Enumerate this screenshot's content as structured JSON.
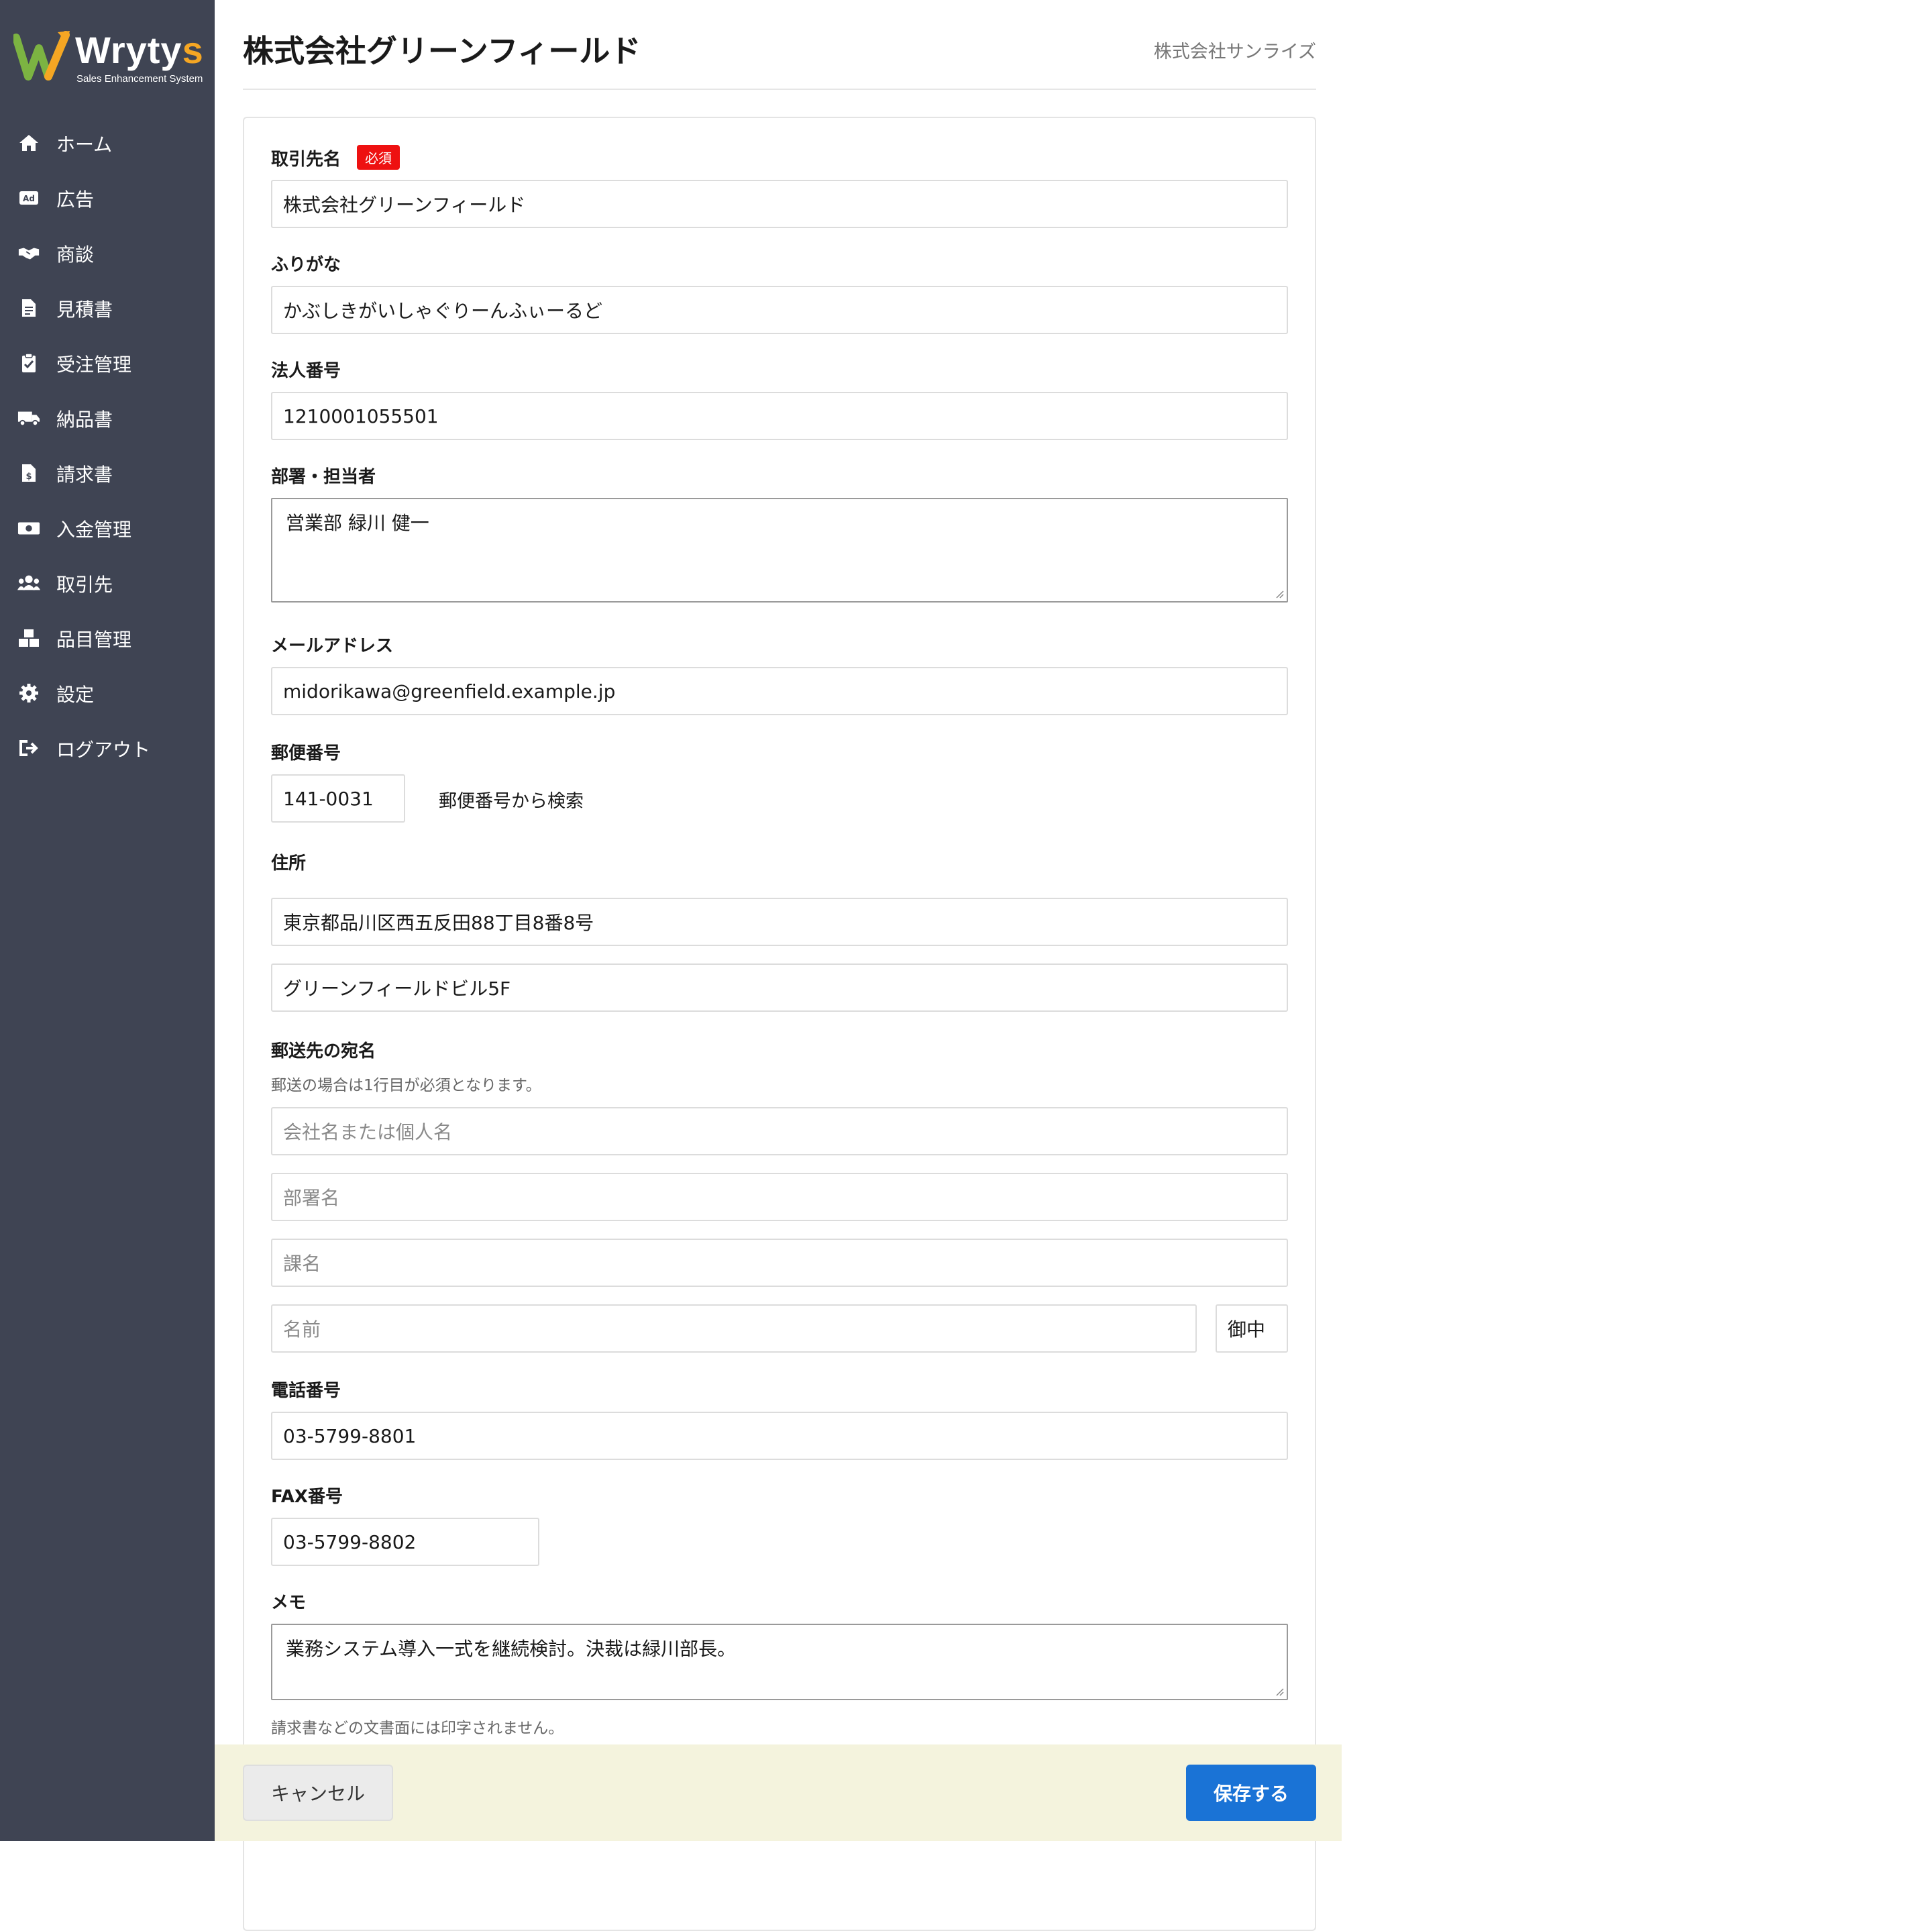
{
  "app": {
    "logo_text_main": "Wryty",
    "logo_text_accent": "s",
    "logo_subtitle": "Sales Enhancement System"
  },
  "sidebar": {
    "items": [
      {
        "label": "ホーム",
        "icon": "home-icon"
      },
      {
        "label": "広告",
        "icon": "ad-icon"
      },
      {
        "label": "商談",
        "icon": "handshake-icon"
      },
      {
        "label": "見積書",
        "icon": "document-icon"
      },
      {
        "label": "受注管理",
        "icon": "clipboard-check-icon"
      },
      {
        "label": "納品書",
        "icon": "truck-icon"
      },
      {
        "label": "請求書",
        "icon": "invoice-icon"
      },
      {
        "label": "入金管理",
        "icon": "money-icon"
      },
      {
        "label": "取引先",
        "icon": "users-icon"
      },
      {
        "label": "品目管理",
        "icon": "boxes-icon"
      },
      {
        "label": "設定",
        "icon": "gear-icon"
      },
      {
        "label": "ログアウト",
        "icon": "logout-icon"
      }
    ]
  },
  "header": {
    "title": "株式会社グリーンフィールド",
    "company": "株式会社サンライズ"
  },
  "form": {
    "client_name": {
      "label": "取引先名",
      "badge": "必須",
      "value": "株式会社グリーンフィールド"
    },
    "furigana": {
      "label": "ふりがな",
      "value": "かぶしきがいしゃぐりーんふぃーるど"
    },
    "corporate_number": {
      "label": "法人番号",
      "value": "1210001055501"
    },
    "department_contact": {
      "label": "部署・担当者",
      "value": "営業部 緑川 健一"
    },
    "email": {
      "label": "メールアドレス",
      "value": "midorikawa@greenfield.example.jp"
    },
    "postal_code": {
      "label": "郵便番号",
      "value": "141-0031",
      "search_link": "郵便番号から検索"
    },
    "address": {
      "label": "住所",
      "line1": "東京都品川区西五反田88丁目8番8号",
      "line2": "グリーンフィールドビル5F"
    },
    "mailing_name": {
      "label": "郵送先の宛名",
      "hint": "郵送の場合は1行目が必須となります。",
      "company_placeholder": "会社名または個人名",
      "department_placeholder": "部署名",
      "section_placeholder": "課名",
      "name_placeholder": "名前",
      "honorific": "御中"
    },
    "phone": {
      "label": "電話番号",
      "value": "03-5799-8801"
    },
    "fax": {
      "label": "FAX番号",
      "value": "03-5799-8802"
    },
    "memo": {
      "label": "メモ",
      "value": "業務システム導入一式を継続検討。決裁は緑川部長。",
      "hint": "請求書などの文書面には印字されません。"
    }
  },
  "footer": {
    "cancel_label": "キャンセル",
    "save_label": "保存する"
  },
  "colors": {
    "sidebar_bg": "#3f4453",
    "required_badge": "#ee1111",
    "save_button": "#1a73d6",
    "footer_bg": "#f4f3dd",
    "logo_accent": "#f5a623"
  }
}
